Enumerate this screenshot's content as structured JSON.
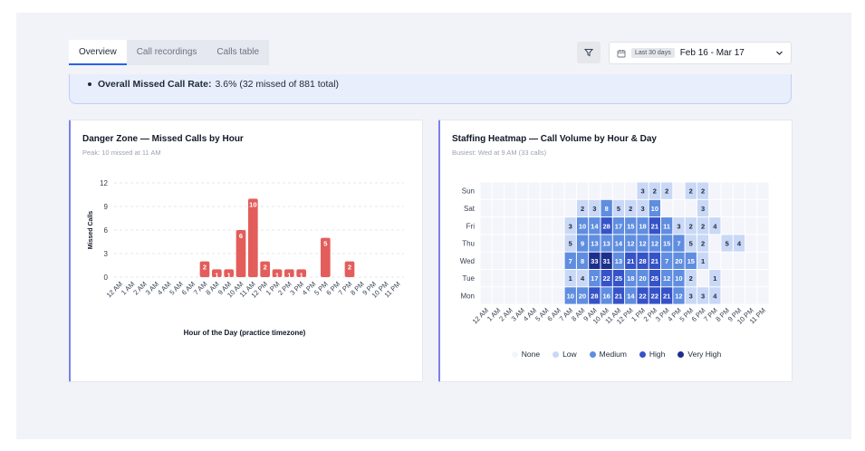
{
  "tabs": [
    {
      "label": "Overview",
      "active": true
    },
    {
      "label": "Call recordings",
      "active": false
    },
    {
      "label": "Calls table",
      "active": false
    }
  ],
  "filter": {
    "icon": "filter-icon"
  },
  "date_range": {
    "badge": "Last 30 days",
    "text": "Feb 16 - Mar 17",
    "icon": "calendar-icon",
    "chevron": "chevron-down-icon"
  },
  "banner": {
    "label": "Overall Missed Call Rate:",
    "value": "3.6% (32 missed of 881 total)"
  },
  "colors": {
    "bar": "#e35d5b",
    "accent": "#7b82e6",
    "none": "#f3f5fb",
    "low": "#c9d8f6",
    "medium": "#5f8de0",
    "high": "#3553c8",
    "very_high": "#1c2f8f"
  },
  "missed_chart": {
    "title": "Danger Zone — Missed Calls by Hour",
    "subtitle": "Peak: 10 missed at 11 AM",
    "chart_data": {
      "type": "bar",
      "title": "Danger Zone — Missed Calls by Hour",
      "xlabel": "Hour of the Day (practice timezone)",
      "ylabel": "Missed Calls",
      "ylim": [
        0,
        12
      ],
      "yticks": [
        "0",
        "3",
        "6",
        "9",
        "12"
      ],
      "categories": [
        "12 AM",
        "1 AM",
        "2 AM",
        "3 AM",
        "4 AM",
        "5 AM",
        "6 AM",
        "7 AM",
        "8 AM",
        "9 AM",
        "10 AM",
        "11 AM",
        "12 PM",
        "1 PM",
        "2 PM",
        "3 PM",
        "4 PM",
        "5 PM",
        "6 PM",
        "7 PM",
        "8 PM",
        "9 PM",
        "10 PM",
        "11 PM"
      ],
      "values": [
        0,
        0,
        0,
        0,
        0,
        0,
        0,
        2,
        1,
        1,
        6,
        10,
        2,
        1,
        1,
        1,
        0,
        5,
        0,
        2,
        0,
        0,
        0,
        0
      ],
      "grid": true
    }
  },
  "heatmap": {
    "title": "Staffing Heatmap — Call Volume by Hour & Day",
    "subtitle": "Busiest: Wed at 9 AM (33 calls)",
    "chart_data": {
      "type": "heatmap",
      "title": "Staffing Heatmap — Call Volume by Hour & Day",
      "rows": [
        "Sun",
        "Sat",
        "Fri",
        "Thu",
        "Wed",
        "Tue",
        "Mon"
      ],
      "columns": [
        "12 AM",
        "1 AM",
        "2 AM",
        "3 AM",
        "4 AM",
        "5 AM",
        "6 AM",
        "7 AM",
        "8 AM",
        "9 AM",
        "10 AM",
        "11 AM",
        "12 PM",
        "1 PM",
        "2 PM",
        "3 PM",
        "4 PM",
        "5 PM",
        "6 PM",
        "7 PM",
        "8 PM",
        "9 PM",
        "10 PM",
        "11 PM"
      ],
      "values": [
        [
          0,
          0,
          0,
          0,
          0,
          0,
          0,
          0,
          0,
          0,
          0,
          0,
          0,
          3,
          2,
          2,
          0,
          2,
          2,
          0,
          0,
          0,
          0,
          0
        ],
        [
          0,
          0,
          0,
          0,
          0,
          0,
          0,
          0,
          2,
          3,
          8,
          5,
          2,
          3,
          10,
          0,
          0,
          0,
          3,
          0,
          0,
          0,
          0,
          0
        ],
        [
          0,
          0,
          0,
          0,
          0,
          0,
          0,
          3,
          10,
          14,
          28,
          17,
          15,
          18,
          21,
          11,
          3,
          2,
          2,
          4,
          0,
          0,
          0,
          0
        ],
        [
          0,
          0,
          0,
          0,
          0,
          0,
          0,
          5,
          9,
          13,
          13,
          14,
          12,
          12,
          12,
          15,
          7,
          5,
          2,
          0,
          5,
          4,
          0,
          0
        ],
        [
          0,
          0,
          0,
          0,
          0,
          0,
          0,
          7,
          8,
          33,
          31,
          13,
          21,
          28,
          21,
          7,
          20,
          15,
          1,
          0,
          0,
          0,
          0,
          0
        ],
        [
          0,
          0,
          0,
          0,
          0,
          0,
          0,
          1,
          4,
          17,
          22,
          25,
          18,
          20,
          25,
          12,
          10,
          2,
          0,
          1,
          0,
          0,
          0,
          0
        ],
        [
          0,
          0,
          0,
          0,
          0,
          0,
          0,
          10,
          20,
          28,
          16,
          21,
          14,
          22,
          22,
          21,
          12,
          3,
          3,
          4,
          0,
          0,
          0,
          0
        ]
      ],
      "legend": [
        "None",
        "Low",
        "Medium",
        "High",
        "Very High"
      ]
    }
  }
}
